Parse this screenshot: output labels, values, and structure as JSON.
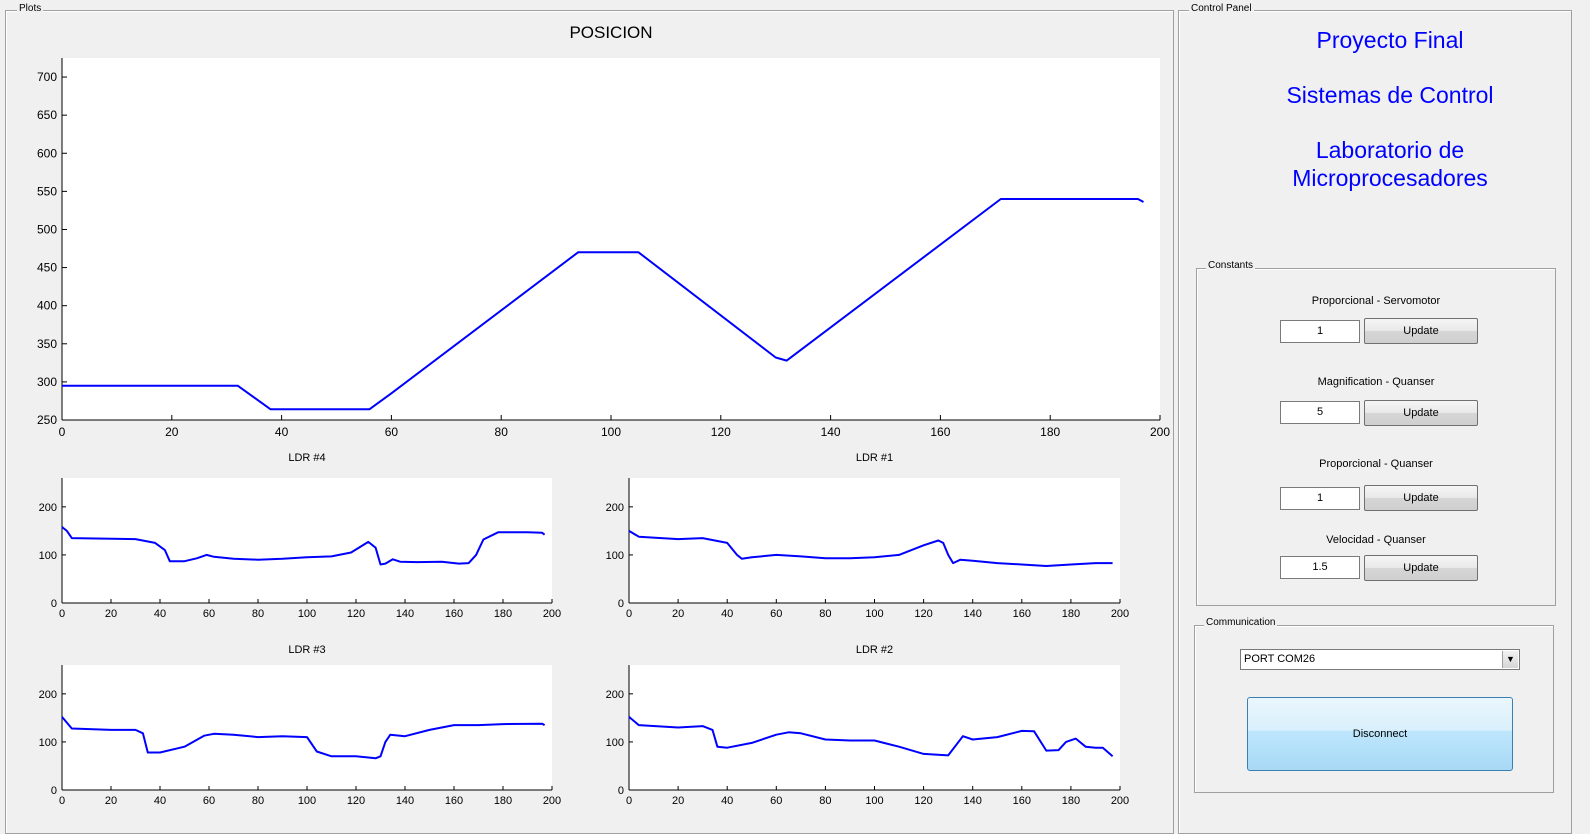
{
  "plots_panel": {
    "title": "Plots"
  },
  "control_panel": {
    "title": "Control Panel"
  },
  "project": {
    "line1": "Proyecto Final",
    "line2": "Sistemas de Control",
    "line3a": "Laboratorio de",
    "line3b": "Microprocesadores"
  },
  "constants": {
    "title": "Constants",
    "items": [
      {
        "label": "Proporcional - Servomotor",
        "value": "1",
        "button": "Update"
      },
      {
        "label": "Magnification - Quanser",
        "value": "5",
        "button": "Update"
      },
      {
        "label": "Proporcional - Quanser",
        "value": "1",
        "button": "Update"
      },
      {
        "label": "Velocidad - Quanser",
        "value": "1.5",
        "button": "Update"
      }
    ]
  },
  "communication": {
    "title": "Communication",
    "port": "PORT COM26",
    "connect_button": "Disconnect"
  },
  "accent_color": "#0000ff",
  "chart_data": [
    {
      "type": "line",
      "title": "POSICION",
      "xlim": [
        0,
        200
      ],
      "ylim": [
        250,
        725
      ],
      "xticks": [
        0,
        20,
        40,
        60,
        80,
        100,
        120,
        140,
        160,
        180,
        200
      ],
      "yticks": [
        250,
        300,
        350,
        400,
        450,
        500,
        550,
        600,
        650,
        700
      ],
      "series": [
        {
          "color": "#0000ff",
          "x": [
            0,
            32,
            38,
            56,
            60,
            94,
            105,
            130,
            132,
            171,
            196,
            197
          ],
          "y": [
            295,
            295,
            264,
            264,
            285,
            470,
            470,
            332,
            328,
            540,
            540,
            536
          ]
        }
      ]
    },
    {
      "type": "line",
      "title": "LDR #4",
      "xlim": [
        0,
        200
      ],
      "ylim": [
        0,
        260
      ],
      "xticks": [
        0,
        20,
        40,
        60,
        80,
        100,
        120,
        140,
        160,
        180,
        200
      ],
      "yticks": [
        0,
        100,
        200
      ],
      "series": [
        {
          "color": "#0000ff",
          "x": [
            0,
            2,
            4,
            30,
            38,
            42,
            44,
            50,
            55,
            59,
            62,
            70,
            80,
            90,
            100,
            110,
            118,
            125,
            128,
            130,
            132,
            135,
            138,
            145,
            155,
            162,
            166,
            169,
            172,
            178,
            190,
            196,
            197
          ],
          "y": [
            158,
            150,
            135,
            133,
            125,
            110,
            87,
            87,
            93,
            100,
            96,
            92,
            90,
            92,
            95,
            97,
            105,
            127,
            115,
            80,
            82,
            91,
            86,
            85,
            86,
            82,
            83,
            100,
            132,
            147,
            147,
            146,
            142
          ]
        }
      ]
    },
    {
      "type": "line",
      "title": "LDR #1",
      "xlim": [
        0,
        200
      ],
      "ylim": [
        0,
        260
      ],
      "xticks": [
        0,
        20,
        40,
        60,
        80,
        100,
        120,
        140,
        160,
        180,
        200
      ],
      "yticks": [
        0,
        100,
        200
      ],
      "series": [
        {
          "color": "#0000ff",
          "x": [
            0,
            4,
            20,
            30,
            40,
            44,
            46,
            50,
            60,
            70,
            80,
            90,
            100,
            110,
            120,
            126,
            128,
            130,
            132,
            135,
            140,
            150,
            160,
            170,
            180,
            190,
            197
          ],
          "y": [
            150,
            138,
            133,
            135,
            125,
            100,
            92,
            95,
            100,
            97,
            93,
            93,
            95,
            100,
            120,
            130,
            125,
            100,
            83,
            90,
            88,
            83,
            80,
            77,
            80,
            83,
            83
          ]
        }
      ]
    },
    {
      "type": "line",
      "title": "LDR #3",
      "xlim": [
        0,
        200
      ],
      "ylim": [
        0,
        260
      ],
      "xticks": [
        0,
        20,
        40,
        60,
        80,
        100,
        120,
        140,
        160,
        180,
        200
      ],
      "yticks": [
        0,
        100,
        200
      ],
      "series": [
        {
          "color": "#0000ff",
          "x": [
            0,
            4,
            20,
            30,
            33,
            35,
            40,
            50,
            58,
            62,
            70,
            80,
            90,
            100,
            104,
            110,
            120,
            128,
            130,
            132,
            134,
            140,
            150,
            160,
            170,
            180,
            196,
            197
          ],
          "y": [
            152,
            128,
            125,
            125,
            118,
            78,
            78,
            90,
            113,
            117,
            115,
            110,
            112,
            110,
            80,
            70,
            70,
            66,
            70,
            100,
            115,
            112,
            125,
            135,
            135,
            137,
            138,
            135
          ]
        }
      ]
    },
    {
      "type": "line",
      "title": "LDR #2",
      "xlim": [
        0,
        200
      ],
      "ylim": [
        0,
        260
      ],
      "xticks": [
        0,
        20,
        40,
        60,
        80,
        100,
        120,
        140,
        160,
        180,
        200
      ],
      "yticks": [
        0,
        100,
        200
      ],
      "series": [
        {
          "color": "#0000ff",
          "x": [
            0,
            4,
            20,
            30,
            34,
            36,
            40,
            50,
            60,
            65,
            70,
            80,
            90,
            100,
            110,
            120,
            130,
            136,
            140,
            150,
            160,
            165,
            170,
            175,
            178,
            182,
            186,
            190,
            193,
            197
          ],
          "y": [
            152,
            135,
            130,
            133,
            125,
            90,
            88,
            98,
            115,
            120,
            118,
            105,
            103,
            103,
            90,
            75,
            72,
            112,
            105,
            110,
            123,
            122,
            82,
            83,
            100,
            107,
            90,
            88,
            88,
            70
          ]
        }
      ]
    }
  ]
}
